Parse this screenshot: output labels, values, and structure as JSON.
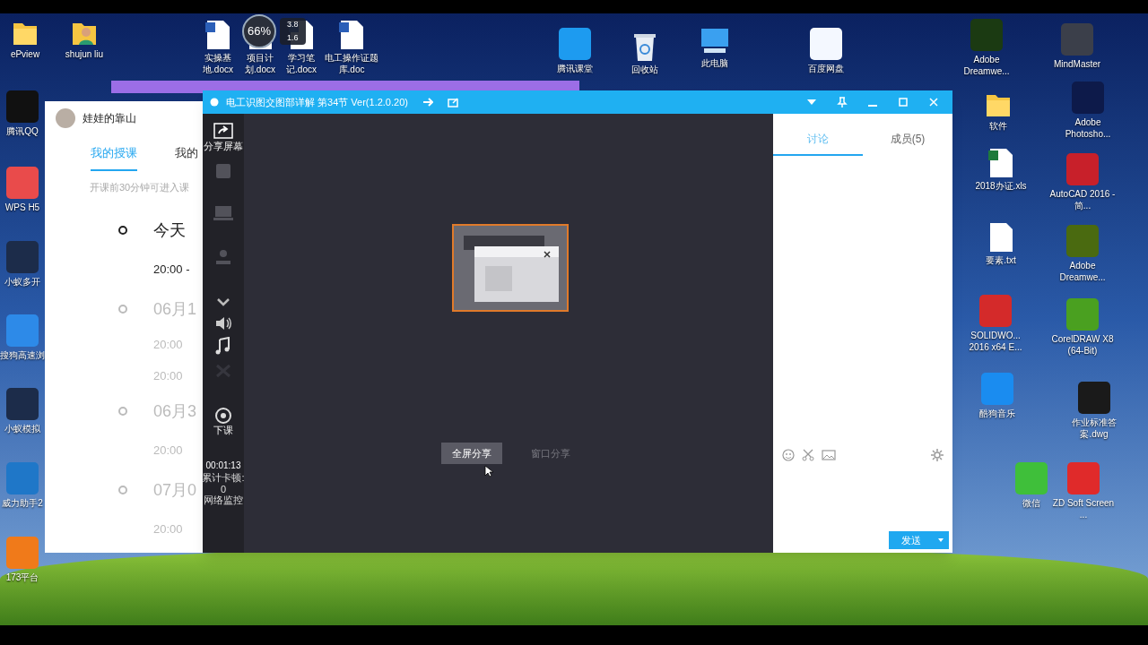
{
  "desktop_icons": [
    {
      "kind": "folder",
      "label": "ePview"
    },
    {
      "kind": "user-folder",
      "label": "shujun liu"
    },
    {
      "kind": "word",
      "label": "实操基地.docx"
    },
    {
      "kind": "word",
      "label": "项目计划.docx"
    },
    {
      "kind": "word",
      "label": "学习笔记.docx"
    },
    {
      "kind": "word",
      "label": "电工操作证题库.doc"
    },
    {
      "kind": "app",
      "label": "腾讯课堂",
      "color": "#1d9bf0"
    },
    {
      "kind": "bin",
      "label": "回收站"
    },
    {
      "kind": "pc",
      "label": "此电脑"
    },
    {
      "kind": "app",
      "label": "百度网盘",
      "color": "#f4f8ff"
    },
    {
      "kind": "app",
      "label": "Adobe Dreamwe...",
      "color": "#1b3a12"
    },
    {
      "kind": "app",
      "label": "MindMaster",
      "color": "#3b3f4a"
    },
    {
      "kind": "app",
      "label": "腾讯QQ",
      "color": "#111111"
    },
    {
      "kind": "app",
      "label": "WPS H5",
      "color": "#e94b4b"
    },
    {
      "kind": "app",
      "label": "小蚁多开",
      "color": "#1c2c4a"
    },
    {
      "kind": "app",
      "label": "搜狗高速浏",
      "color": "#2d8ae8"
    },
    {
      "kind": "app",
      "label": "小蚁模拟",
      "color": "#1c2c4a"
    },
    {
      "kind": "app",
      "label": "威力助手2",
      "color": "#1f77c8"
    },
    {
      "kind": "app",
      "label": "173平台",
      "color": "#f07a1a"
    },
    {
      "kind": "folder",
      "label": "软件"
    },
    {
      "kind": "excel",
      "label": "2018办证.xls"
    },
    {
      "kind": "file",
      "label": "要素.txt"
    },
    {
      "kind": "app",
      "label": "SOLIDWO... 2016 x64 E...",
      "color": "#d42a2a"
    },
    {
      "kind": "app",
      "label": "酷狗音乐",
      "color": "#1a8cf0"
    },
    {
      "kind": "app",
      "label": "微信",
      "color": "#3fbf3a"
    },
    {
      "kind": "app",
      "label": "Adobe Photosho...",
      "color": "#0d1a4a"
    },
    {
      "kind": "app",
      "label": "AutoCAD 2016 - 简...",
      "color": "#c8202a"
    },
    {
      "kind": "app",
      "label": "Adobe Dreamwe...",
      "color": "#4a6a10"
    },
    {
      "kind": "app",
      "label": "CorelDRAW X8 (64-Bit)",
      "color": "#4aa020"
    },
    {
      "kind": "app",
      "label": "作业标准答案.dwg",
      "color": "#1a1a1a"
    },
    {
      "kind": "app",
      "label": "ZD Soft Screen ...",
      "color": "#e02a2a"
    }
  ],
  "speed_widget": {
    "percent": "66%",
    "upload": "3.8",
    "download": "1.6"
  },
  "course_window": {
    "user": "娃娃的靠山",
    "tabs": [
      {
        "label": "我的授课",
        "selected": true
      },
      {
        "label": "我的",
        "selected": false
      }
    ],
    "hint": "开课前30分钟可进入课",
    "timeline": [
      {
        "date": "今天",
        "selected": true,
        "times": [
          "20:00 -"
        ]
      },
      {
        "date": "06月1",
        "selected": false,
        "times": [
          "20:00",
          "20:00"
        ]
      },
      {
        "date": "06月3",
        "selected": false,
        "times": [
          "20:00"
        ]
      },
      {
        "date": "07月0",
        "selected": false,
        "times": [
          "20:00"
        ]
      }
    ]
  },
  "class_window": {
    "title": "电工识图交图部详解  第34节 Ver(1.2.0.20)",
    "tools": [
      {
        "kind": "share",
        "label": "分享屏幕",
        "disabled": false
      },
      {
        "kind": "camera",
        "disabled": true
      },
      {
        "kind": "screen",
        "disabled": true
      },
      {
        "kind": "person",
        "disabled": true
      },
      {
        "kind": "chevron",
        "disabled": false
      },
      {
        "kind": "speaker",
        "disabled": false
      },
      {
        "kind": "music",
        "disabled": false
      },
      {
        "kind": "mic",
        "disabled": true
      },
      {
        "kind": "power",
        "label": "下课",
        "disabled": false
      }
    ],
    "timer": "00:01:13",
    "lag_label": "累计卡顿:",
    "lag_value": "0",
    "network_label": "网络监控",
    "share_buttons": [
      {
        "label": "全屏分享",
        "hovered": true
      },
      {
        "label": "窗口分享",
        "hovered": false
      }
    ],
    "panel_tabs": [
      {
        "label": "讨论",
        "selected": true
      },
      {
        "label": "成员(5)",
        "selected": false
      }
    ],
    "send_label": "发送"
  }
}
